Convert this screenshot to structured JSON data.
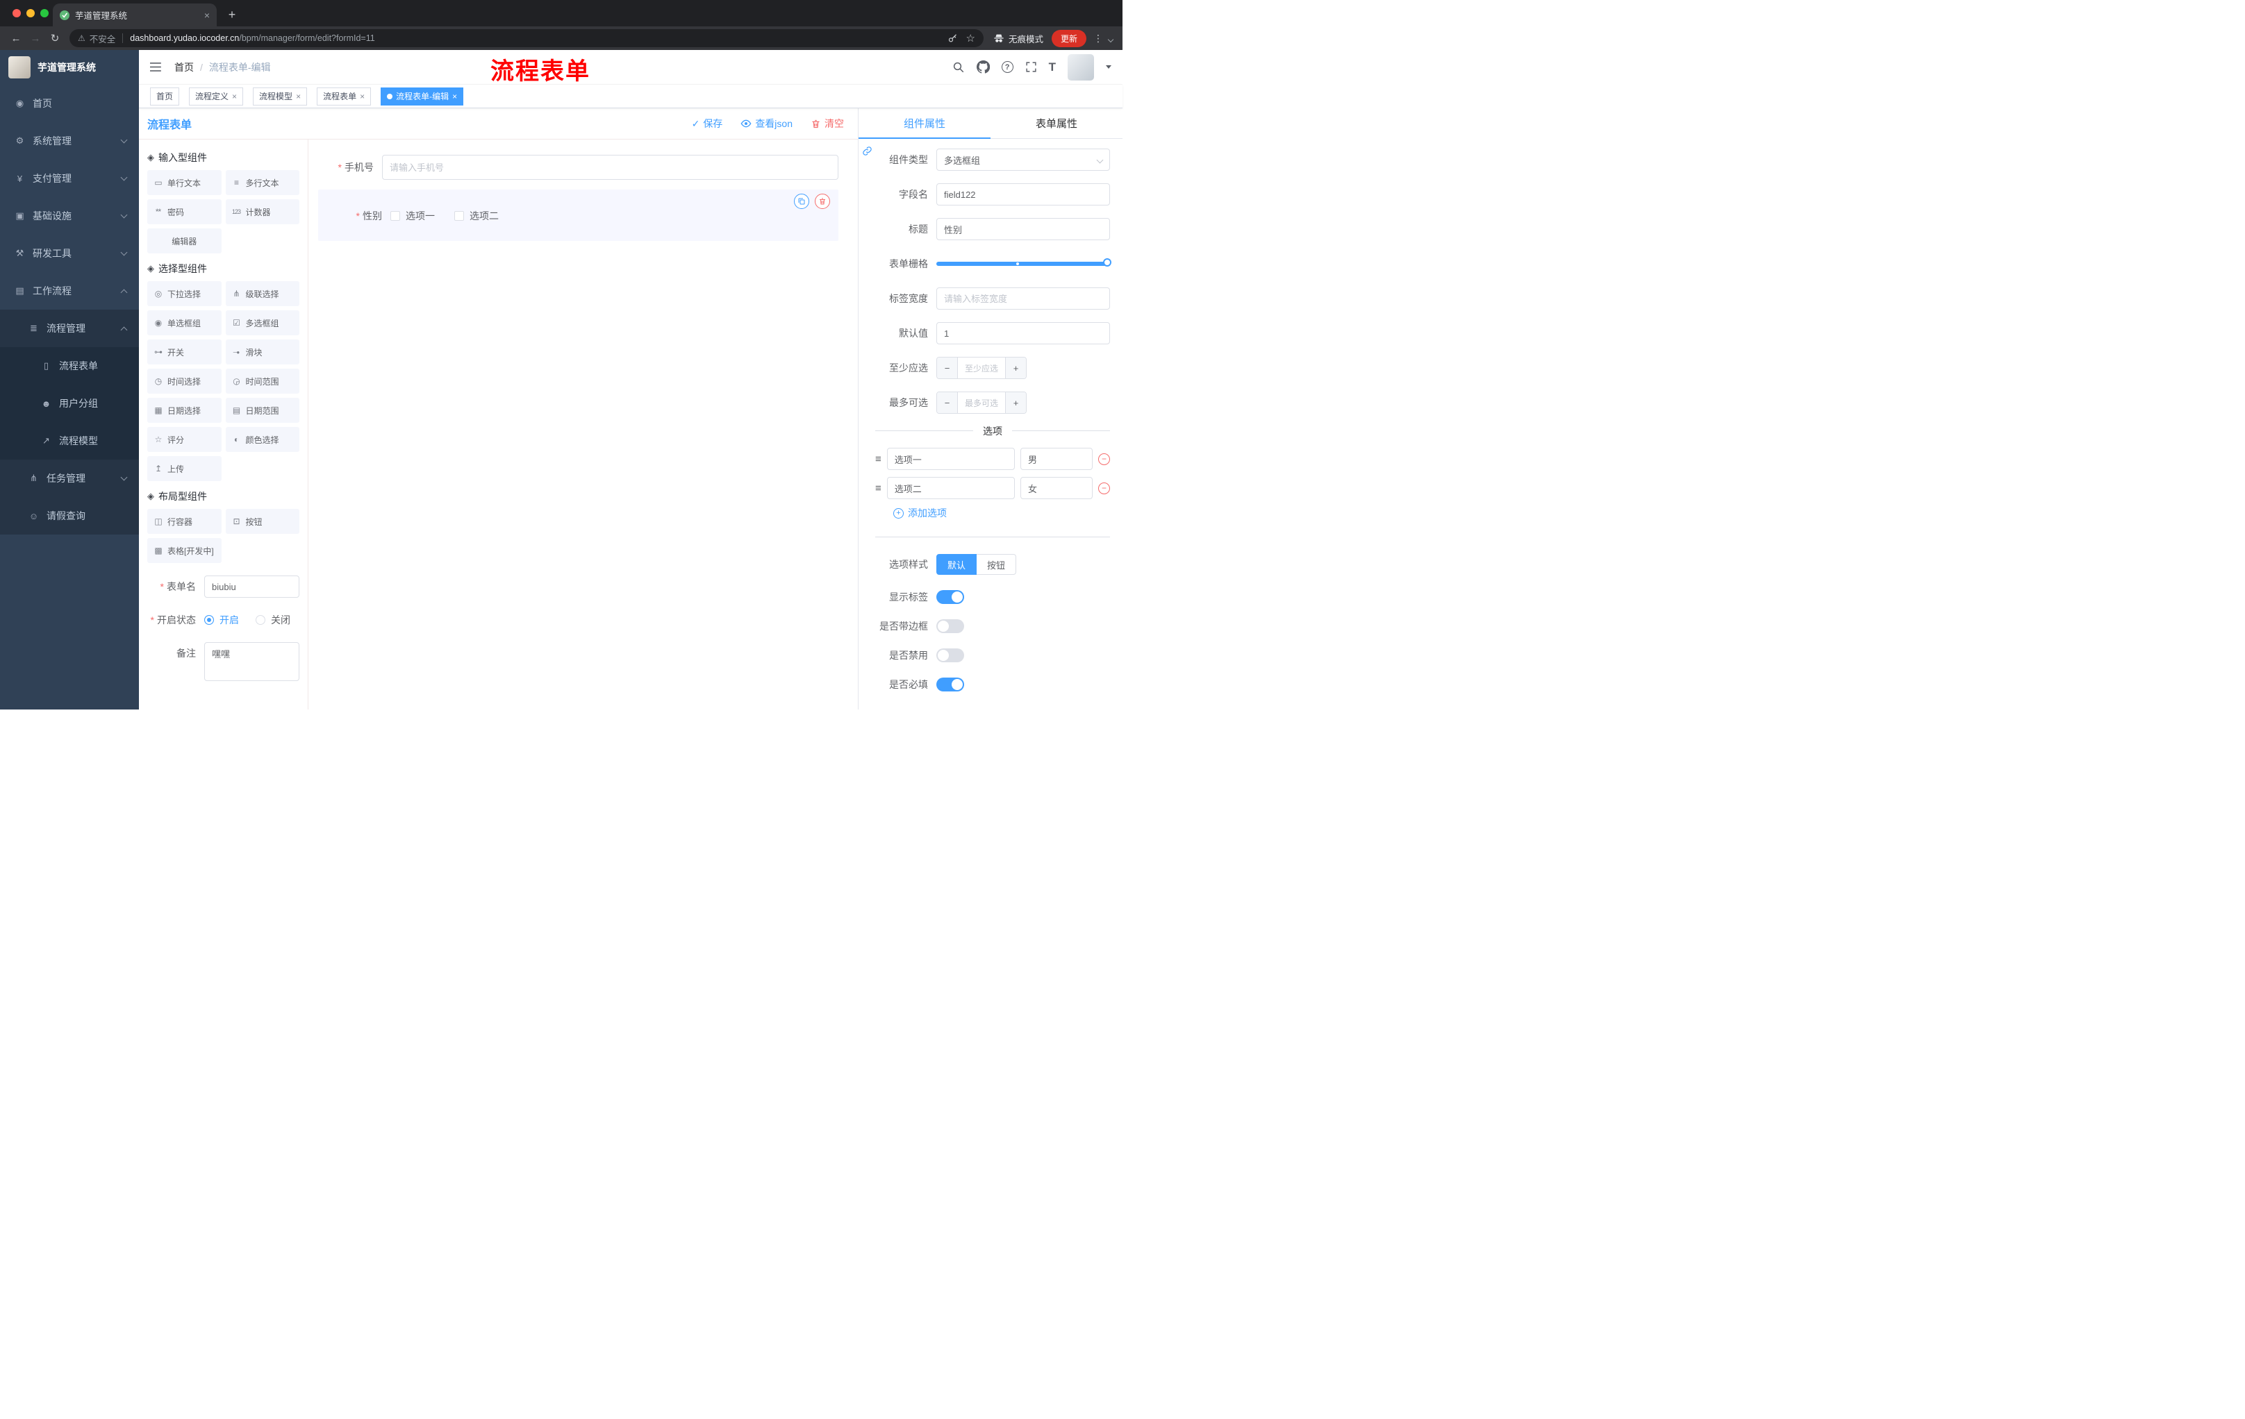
{
  "glyphs": {
    "close": "×",
    "plus": "+",
    "minus": "−",
    "dots_v": "⋮",
    "back": "←",
    "forward": "→",
    "reload": "↻",
    "warning": "⚠",
    "star": "☆",
    "drag": "≡",
    "help": "?",
    "font_size": "T",
    "check": "✓"
  },
  "browser": {
    "tab_title": "芋道管理系统",
    "security": "不安全",
    "host": "dashboard.yudao.iocoder.cn",
    "path": "/bpm/manager/form/edit?formId=11",
    "incognito": "无痕模式",
    "update": "更新"
  },
  "annotation": "流程表单",
  "sidebar": {
    "logo_title": "芋道管理系统",
    "items": [
      {
        "label": "首页",
        "glyph": "◉"
      },
      {
        "label": "系统管理",
        "glyph": "⚙"
      },
      {
        "label": "支付管理",
        "glyph": "¥"
      },
      {
        "label": "基础设施",
        "glyph": "▣"
      },
      {
        "label": "研发工具",
        "glyph": "⚒"
      },
      {
        "label": "工作流程",
        "glyph": "▤"
      },
      {
        "label": "流程管理",
        "glyph": "≣"
      },
      {
        "label": "流程表单",
        "glyph": "▯"
      },
      {
        "label": "用户分组",
        "glyph": "☻"
      },
      {
        "label": "流程模型",
        "glyph": "↗"
      },
      {
        "label": "任务管理",
        "glyph": "⋔"
      },
      {
        "label": "请假查询",
        "glyph": "☺"
      }
    ]
  },
  "header": {
    "breadcrumb_root": "首页",
    "breadcrumb_sep": "/",
    "breadcrumb_current": "流程表单-编辑"
  },
  "tags": [
    {
      "label": "首页"
    },
    {
      "label": "流程定义"
    },
    {
      "label": "流程模型"
    },
    {
      "label": "流程表单"
    },
    {
      "label": "流程表单-编辑"
    }
  ],
  "page": {
    "title": "流程表单",
    "save": "保存",
    "view_json": "查看json",
    "clear": "清空"
  },
  "palette": {
    "groups": [
      {
        "title": "输入型组件",
        "items": [
          {
            "label": "单行文本",
            "glyph": "▭"
          },
          {
            "label": "多行文本",
            "glyph": "≡"
          },
          {
            "label": "密码",
            "glyph": "**"
          },
          {
            "label": "计数器",
            "glyph": "123"
          },
          {
            "label": "编辑器",
            "glyph": ""
          }
        ]
      },
      {
        "title": "选择型组件",
        "items": [
          {
            "label": "下拉选择",
            "glyph": "◎"
          },
          {
            "label": "级联选择",
            "glyph": "⋔"
          },
          {
            "label": "单选框组",
            "glyph": "◉"
          },
          {
            "label": "多选框组",
            "glyph": "☑"
          },
          {
            "label": "开关",
            "glyph": "⊶"
          },
          {
            "label": "滑块",
            "glyph": "─●"
          },
          {
            "label": "时间选择",
            "glyph": "◷"
          },
          {
            "label": "时间范围",
            "glyph": "◶"
          },
          {
            "label": "日期选择",
            "glyph": "▦"
          },
          {
            "label": "日期范围",
            "glyph": "▤"
          },
          {
            "label": "评分",
            "glyph": "☆"
          },
          {
            "label": "颜色选择",
            "glyph": "◐"
          },
          {
            "label": "上传",
            "glyph": "↥"
          }
        ]
      },
      {
        "title": "布局型组件",
        "items": [
          {
            "label": "行容器",
            "glyph": "◫"
          },
          {
            "label": "按钮",
            "glyph": "⊡"
          },
          {
            "label": "表格[开发中]",
            "glyph": "▩"
          }
        ]
      }
    ],
    "form": {
      "name_label": "表单名",
      "name_value": "biubiu",
      "status_label": "开启状态",
      "status_on": "开启",
      "status_off": "关闭",
      "remark_label": "备注",
      "remark_value": "嘿嘿"
    }
  },
  "canvas": {
    "phone": {
      "label": "手机号",
      "placeholder": "请输入手机号"
    },
    "gender": {
      "label": "性别",
      "opt1": "选项一",
      "opt2": "选项二"
    }
  },
  "props": {
    "tab_component": "组件属性",
    "tab_form": "表单属性",
    "component_type": {
      "label": "组件类型",
      "value": "多选框组"
    },
    "field_name": {
      "label": "字段名",
      "value": "field122"
    },
    "title": {
      "label": "标题",
      "value": "性别"
    },
    "grid": {
      "label": "表单栅格"
    },
    "label_width": {
      "label": "标签宽度",
      "placeholder": "请输入标签宽度"
    },
    "default_value": {
      "label": "默认值",
      "value": "1"
    },
    "min_select": {
      "label": "至少应选",
      "placeholder": "至少应选"
    },
    "max_select": {
      "label": "最多可选",
      "placeholder": "最多可选"
    },
    "options_title": "选项",
    "options": [
      {
        "label": "选项一",
        "value": "男"
      },
      {
        "label": "选项二",
        "value": "女"
      }
    ],
    "add_option": "添加选项",
    "option_style": {
      "label": "选项样式",
      "default": "默认",
      "button": "按钮"
    },
    "show_label": {
      "label": "显示标签",
      "on": true
    },
    "border": {
      "label": "是否带边框",
      "on": false
    },
    "disabled": {
      "label": "是否禁用",
      "on": false
    },
    "required": {
      "label": "是否必填",
      "on": true
    }
  },
  "colors": {
    "primary": "#409EFF",
    "danger": "#F56C6C",
    "annotation": "#FF0000",
    "sidebar_bg": "#304156",
    "sidebar_sub_bg": "#1F2D3D",
    "update_button": "#D93025"
  }
}
